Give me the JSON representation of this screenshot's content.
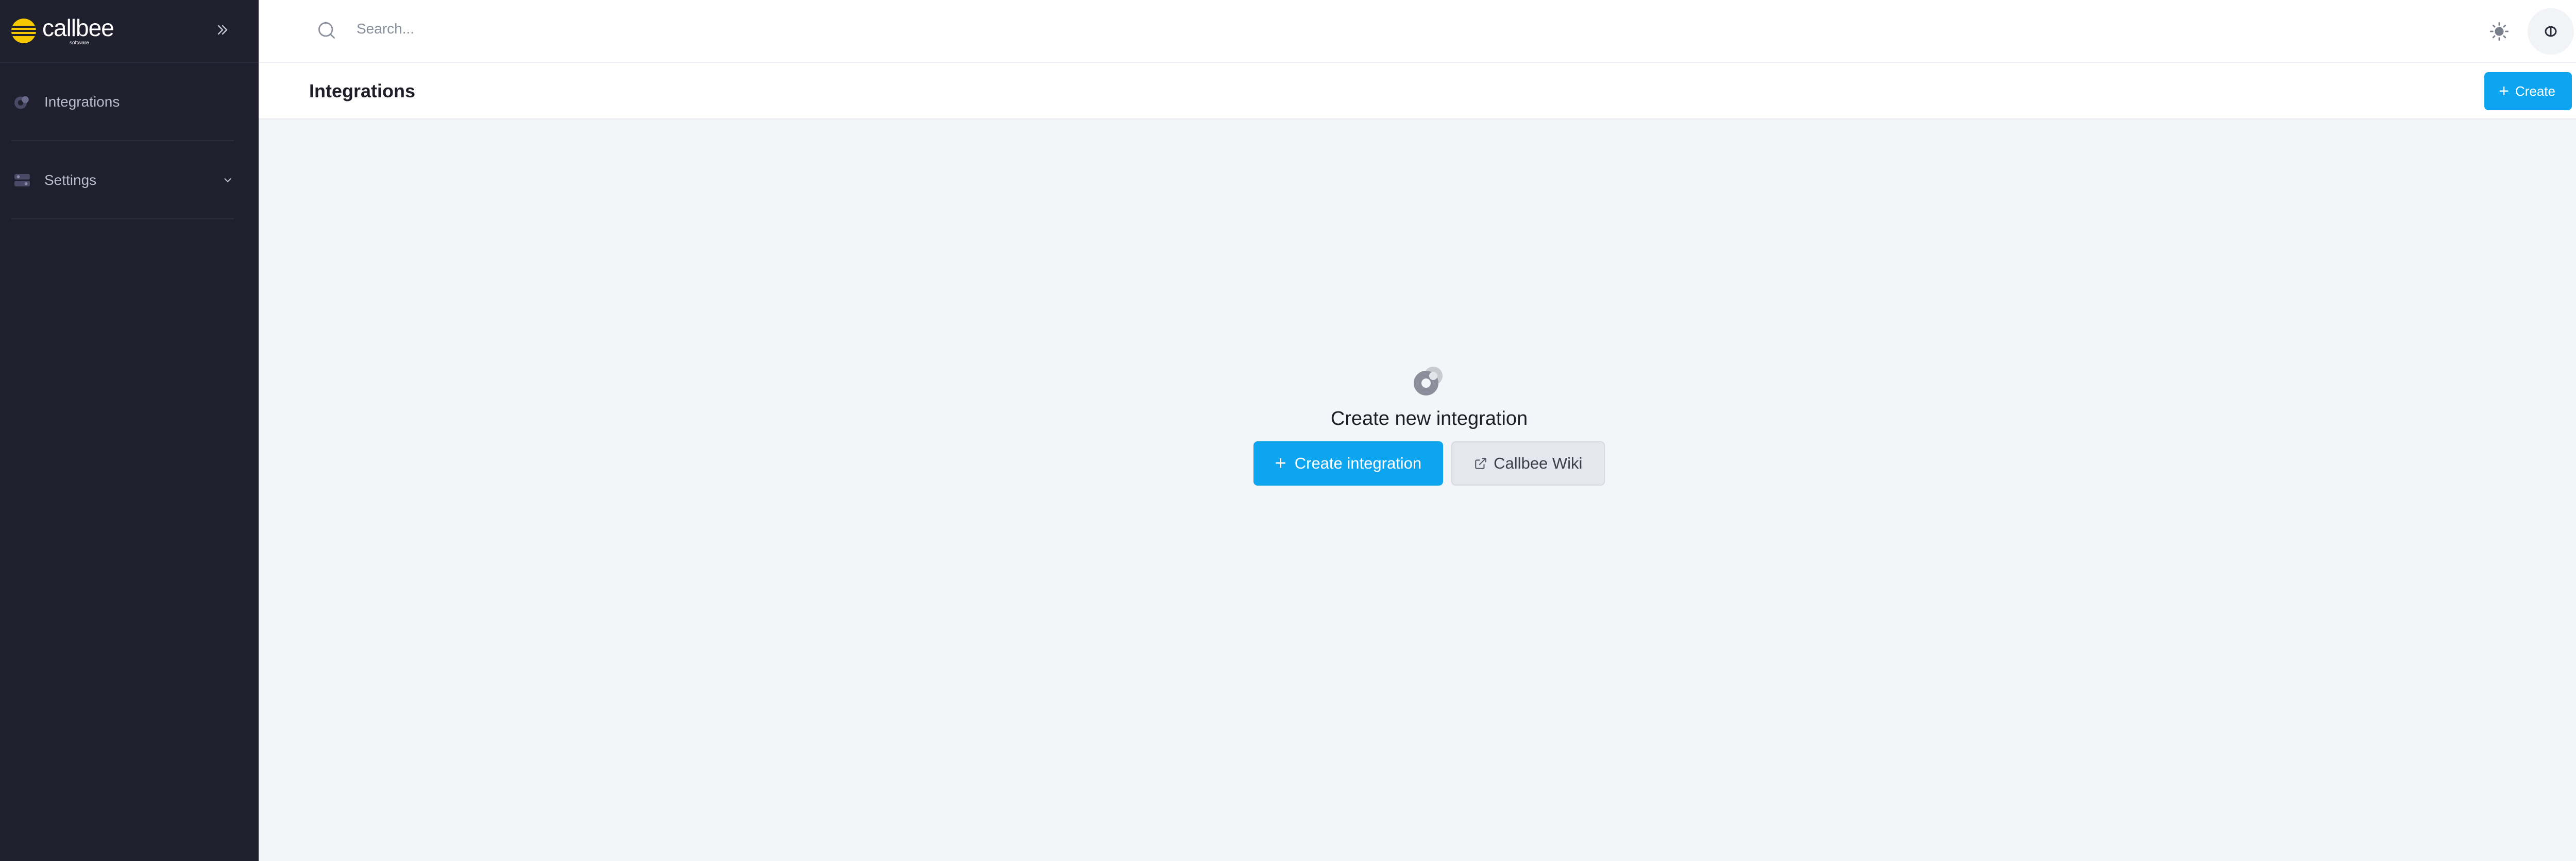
{
  "brand": {
    "name": "callbee",
    "sub": "software",
    "accent": "#0ea5f0",
    "logo_color": "#f5c800",
    "sidebar_bg": "#1f1f2e"
  },
  "sidebar": {
    "collapse_icon": "chevrons-right-icon",
    "items": [
      {
        "label": "Integrations",
        "icon": "integrations-icon"
      },
      {
        "label": "Settings",
        "icon": "settings-icon",
        "chevron": "chevron-down-icon"
      }
    ]
  },
  "topbar": {
    "search_placeholder": "Search...",
    "theme_icon": "sun-icon",
    "avatar_icon": "user-avatar-icon"
  },
  "page": {
    "title": "Integrations",
    "create_label": "Create"
  },
  "empty_state": {
    "icon": "integration-icon",
    "title": "Create new integration",
    "primary_label": "Create integration",
    "secondary_label": "Callbee Wiki",
    "secondary_icon": "external-link-icon"
  }
}
